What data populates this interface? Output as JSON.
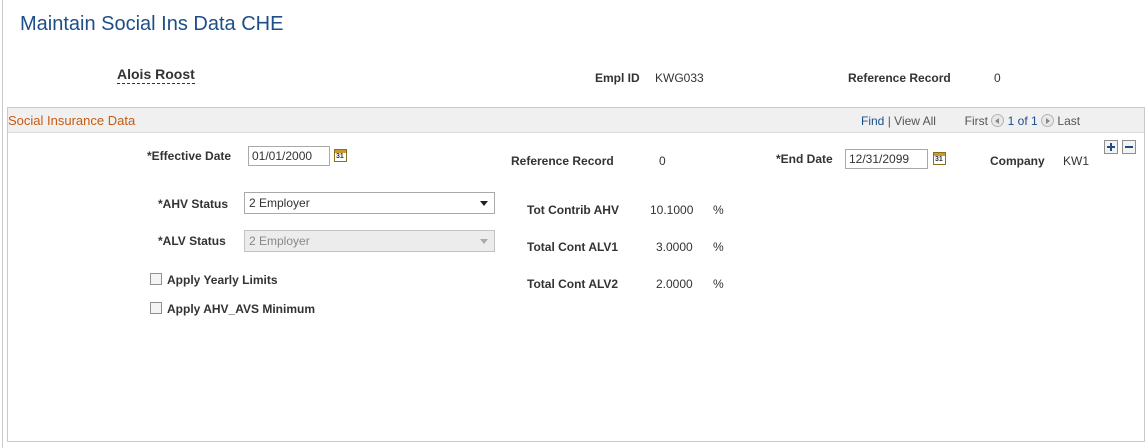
{
  "page": {
    "title": "Maintain Social Ins Data CHE"
  },
  "employee": {
    "name": "Alois Roost",
    "empl_id_label": "Empl ID",
    "empl_id": "KWG033",
    "ref_record_label": "Reference Record",
    "ref_record": "0"
  },
  "section": {
    "title": "Social Insurance Data",
    "find": "Find",
    "separator": "|",
    "view_all": "View All",
    "first": "First",
    "counter": "1 of 1",
    "last": "Last"
  },
  "form": {
    "effective_date_label": "*Effective Date",
    "effective_date": "01/01/2000",
    "reference_record_label": "Reference Record",
    "reference_record": "0",
    "end_date_label": "*End Date",
    "end_date": "12/31/2099",
    "company_label": "Company",
    "company": "KW1",
    "ahv_status_label": "*AHV Status",
    "ahv_status": "2 Employer",
    "alv_status_label": "*ALV Status",
    "alv_status": "2 Employer",
    "tot_contrib_ahv_label": "Tot Contrib AHV",
    "tot_contrib_ahv": "10.1000",
    "total_cont_alv1_label": "Total Cont ALV1",
    "total_cont_alv1": "3.0000",
    "total_cont_alv2_label": "Total Cont ALV2",
    "total_cont_alv2": "2.0000",
    "percent": "%",
    "apply_yearly_limits_label": "Apply Yearly Limits",
    "apply_ahv_avs_minimum_label": "Apply AHV_AVS Minimum"
  },
  "icons": {
    "calendar": "calendar-icon",
    "calendar_glyph": "31",
    "add": "plus-icon",
    "delete": "minus-icon"
  },
  "colors": {
    "title": "#1d4e89",
    "section_title": "#c75b12",
    "link": "#1d4e89"
  }
}
